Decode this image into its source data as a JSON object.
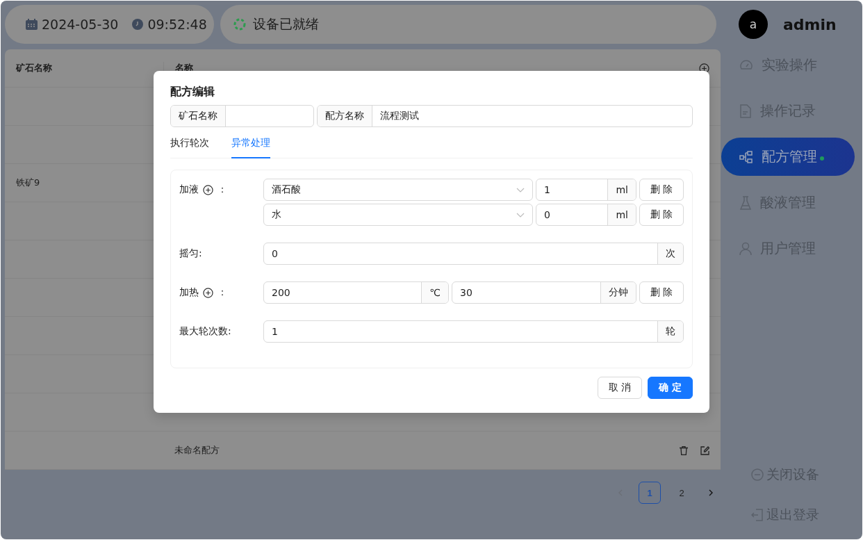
{
  "header": {
    "date": "2024-05-30",
    "time": "09:52:48",
    "status": "设备已就绪"
  },
  "table": {
    "columns": [
      {
        "label": "矿石名称"
      },
      {
        "label": "名称"
      }
    ],
    "rows": [
      {},
      {},
      {
        "ore_name": "铁矿9"
      },
      {},
      {},
      {},
      {},
      {},
      {},
      {
        "name": "未命名配方",
        "actions": true
      }
    ],
    "pagination": {
      "pages": [
        {
          "label": "1",
          "selected": true
        },
        {
          "label": "2",
          "selected": false
        }
      ],
      "prev_disabled": true,
      "next_disabled": false
    }
  },
  "sidebar": {
    "avatar": "a",
    "username": "admin",
    "items": [
      {
        "label": "实验操作",
        "selected": false,
        "dot": false
      },
      {
        "label": "操作记录",
        "selected": false,
        "dot": false
      },
      {
        "label": "配方管理",
        "selected": true,
        "dot": true
      },
      {
        "label": "酸液管理",
        "selected": false,
        "dot": false
      },
      {
        "label": "用户管理",
        "selected": false,
        "dot": false
      }
    ],
    "bottom": [
      {
        "label": "关闭设备"
      },
      {
        "label": "退出登录"
      }
    ]
  },
  "dialog": {
    "title": "配方编辑",
    "fields": [
      {
        "label": "矿石名称"
      },
      {
        "label": "配方名称",
        "value": "流程测试"
      }
    ],
    "tabs": [
      {
        "label": "执行轮次",
        "selected": false
      },
      {
        "label": "异常处理",
        "selected": true
      }
    ],
    "rows": [
      {
        "kind": "liquid",
        "label": "加液",
        "colon": "：",
        "entries": [
          {
            "reagent": "酒石酸",
            "amount": "1",
            "unit": "ml",
            "delete": "删 除"
          },
          {
            "reagent": "水",
            "amount": "0",
            "unit": "ml",
            "delete": "删 除"
          }
        ]
      },
      {
        "kind": "input",
        "label": "摇匀:",
        "value": "0",
        "unit": "次"
      },
      {
        "kind": "heat",
        "label": "加热",
        "colon": "：",
        "temperature": "200",
        "temperature_unit": "℃",
        "duration": "30",
        "duration_unit": "分钟",
        "delete": "删 除"
      },
      {
        "kind": "input",
        "label": "最大轮次数:",
        "value": "1",
        "unit": "轮"
      }
    ],
    "buttons": [
      {
        "label": "取 消",
        "kind": "default"
      },
      {
        "label": "确 定",
        "kind": "primary"
      }
    ]
  }
}
